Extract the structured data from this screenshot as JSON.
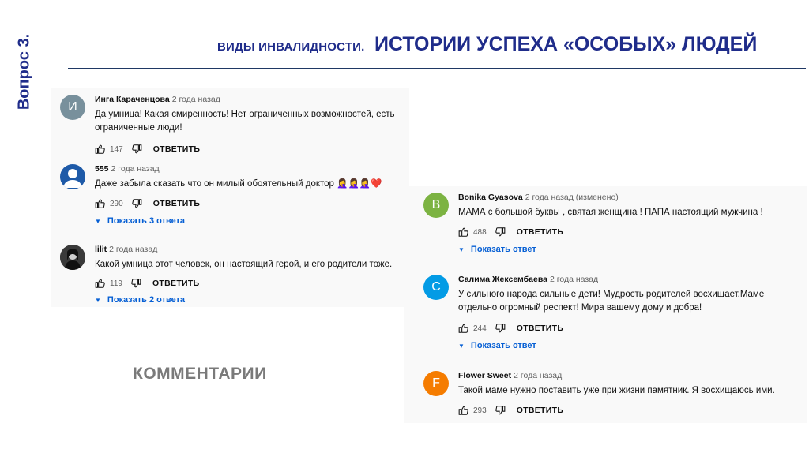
{
  "slide": {
    "vertical_label": "Вопрос 3.",
    "title_small": "ВИДЫ ИНВАЛИДНОСТИ.",
    "title_large": "ИСТОРИИ УСПЕХА «ОСОБЫХ» ЛЮДЕЙ",
    "watermark": "КОММЕНТАРИИ"
  },
  "left_comments": [
    {
      "avatar_letter": "И",
      "avatar_color": "#78909c",
      "author": "Инга Караченцова",
      "time": "2 года назад",
      "text": "Да умница! Какая смиренность!  Нет ограниченных возможностей, есть ограниченные люди!",
      "likes": "147",
      "reply": "ОТВЕТИТЬ"
    },
    {
      "avatar_icon": "person-icon",
      "avatar_color": "#1e5aa8",
      "author": "555",
      "time": "2 года назад",
      "text": "Даже забыла сказать  что он милый обоятельный доктор 🤦‍♀️🤦‍♀️🤦‍♀️❤️",
      "likes": "290",
      "reply": "ОТВЕТИТЬ",
      "show_replies": "Показать 3 ответа"
    },
    {
      "avatar_icon": "photo-avatar",
      "avatar_color": "#2a2a2a",
      "author": "lilit",
      "time": "2 года назад",
      "text": "Какой умница этот человек, он настоящий герой, и его родители тоже.",
      "likes": "119",
      "reply": "ОТВЕТИТЬ",
      "show_replies": "Показать 2 ответа"
    }
  ],
  "right_comments": [
    {
      "avatar_letter": "B",
      "avatar_color": "#7cb342",
      "author": "Bonika Gyasova",
      "time": "2 года назад (изменено)",
      "text": "МАМА с большой буквы , святая женщина ! ПАПА настоящий мужчина !",
      "likes": "488",
      "reply": "ОТВЕТИТЬ",
      "show_replies": "Показать ответ"
    },
    {
      "avatar_letter": "С",
      "avatar_color": "#039be5",
      "author": "Салима Жексембаева",
      "time": "2 года назад",
      "text": "У сильного народа сильные дети! Мудрость родителей  восхищает.Маме отдельно огромный респект! Мира вашему дому и добра!",
      "likes": "244",
      "reply": "ОТВЕТИТЬ",
      "show_replies": "Показать ответ"
    },
    {
      "avatar_letter": "F",
      "avatar_color": "#f57c00",
      "author": "Flower Sweet",
      "time": "2 года назад",
      "text": "Такой маме нужно поставить уже при жизни памятник. Я восхищаюсь ими.",
      "likes": "293",
      "reply": "ОТВЕТИТЬ"
    }
  ]
}
